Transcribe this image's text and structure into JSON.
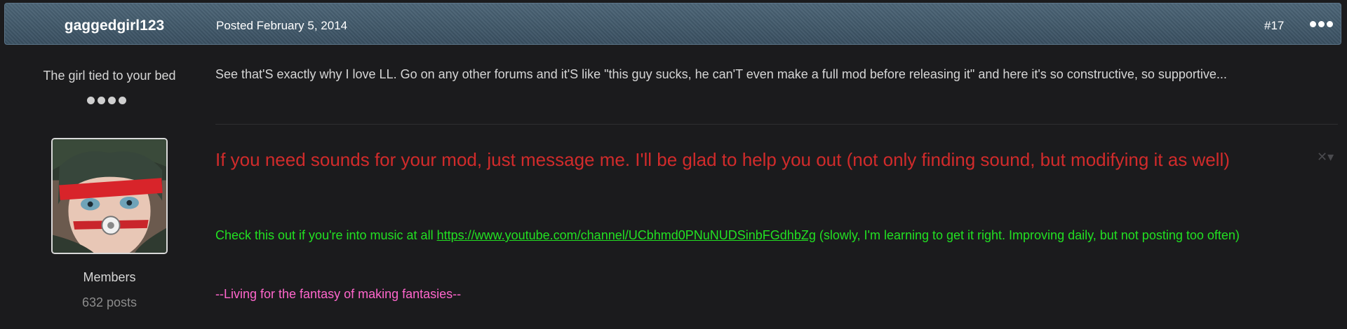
{
  "header": {
    "username": "gaggedgirl123",
    "posted": "Posted February 5, 2014",
    "post_number": "#17"
  },
  "author": {
    "title": "The girl tied to your bed",
    "group": "Members",
    "post_count": "632 posts"
  },
  "post": {
    "body": "See that'S exactly why I love LL. Go on any other forums and it'S like \"this guy sucks, he can'T even make a full mod before releasing it\" and here it's so constructive, so supportive..."
  },
  "signature": {
    "red_text": "If you need sounds for your mod, just message me. I'll be glad to help you out (not only finding sound, but modifying it as well)",
    "green_prefix": "Check this out if you're into music at all ",
    "link_text": "https://www.youtube.com/channel/UCbhmd0PNuNUDSinbFGdhbZg",
    "green_suffix": " (slowly, I'm learning to get it right. Improving daily, but not posting too often)",
    "pink_text": "--Living for the fantasy of making fantasies--",
    "close_glyph": "✕▾"
  },
  "icons": {
    "more": "more-options-icon",
    "rank": "rank-dots-icon",
    "close": "close-signature-icon"
  },
  "colors": {
    "header_bg": "#3e5566",
    "page_bg": "#1b1b1d",
    "signature_red": "#d12b2b",
    "signature_green": "#22e022",
    "signature_pink": "#ff66cc"
  }
}
